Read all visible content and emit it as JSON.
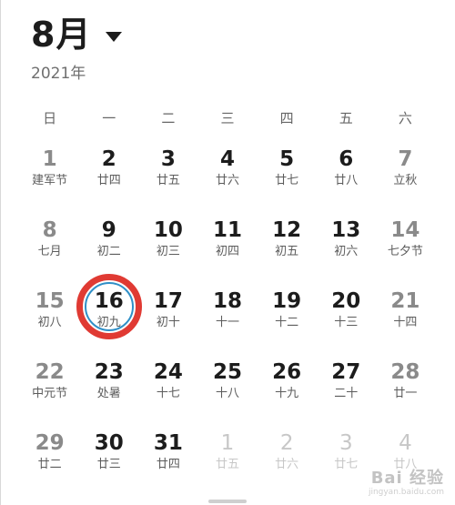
{
  "header": {
    "month_title": "8月",
    "year": "2021年"
  },
  "weekdays": [
    "日",
    "一",
    "二",
    "三",
    "四",
    "五",
    "六"
  ],
  "days": [
    {
      "num": "1",
      "lunar": "建军节",
      "kind": "weekend"
    },
    {
      "num": "2",
      "lunar": "廿四",
      "kind": "normal"
    },
    {
      "num": "3",
      "lunar": "廿五",
      "kind": "normal"
    },
    {
      "num": "4",
      "lunar": "廿六",
      "kind": "normal"
    },
    {
      "num": "5",
      "lunar": "廿七",
      "kind": "normal"
    },
    {
      "num": "6",
      "lunar": "廿八",
      "kind": "normal"
    },
    {
      "num": "7",
      "lunar": "立秋",
      "kind": "weekend"
    },
    {
      "num": "8",
      "lunar": "七月",
      "kind": "weekend"
    },
    {
      "num": "9",
      "lunar": "初二",
      "kind": "normal"
    },
    {
      "num": "10",
      "lunar": "初三",
      "kind": "normal"
    },
    {
      "num": "11",
      "lunar": "初四",
      "kind": "normal"
    },
    {
      "num": "12",
      "lunar": "初五",
      "kind": "normal"
    },
    {
      "num": "13",
      "lunar": "初六",
      "kind": "normal"
    },
    {
      "num": "14",
      "lunar": "七夕节",
      "kind": "weekend"
    },
    {
      "num": "15",
      "lunar": "初八",
      "kind": "weekend"
    },
    {
      "num": "16",
      "lunar": "初九",
      "kind": "today"
    },
    {
      "num": "17",
      "lunar": "初十",
      "kind": "normal"
    },
    {
      "num": "18",
      "lunar": "十一",
      "kind": "normal"
    },
    {
      "num": "19",
      "lunar": "十二",
      "kind": "normal"
    },
    {
      "num": "20",
      "lunar": "十三",
      "kind": "normal"
    },
    {
      "num": "21",
      "lunar": "十四",
      "kind": "weekend"
    },
    {
      "num": "22",
      "lunar": "中元节",
      "kind": "weekend"
    },
    {
      "num": "23",
      "lunar": "处暑",
      "kind": "normal"
    },
    {
      "num": "24",
      "lunar": "十七",
      "kind": "normal"
    },
    {
      "num": "25",
      "lunar": "十八",
      "kind": "normal"
    },
    {
      "num": "26",
      "lunar": "十九",
      "kind": "normal"
    },
    {
      "num": "27",
      "lunar": "二十",
      "kind": "normal"
    },
    {
      "num": "28",
      "lunar": "廿一",
      "kind": "weekend"
    },
    {
      "num": "29",
      "lunar": "廿二",
      "kind": "weekend"
    },
    {
      "num": "30",
      "lunar": "廿三",
      "kind": "normal"
    },
    {
      "num": "31",
      "lunar": "廿四",
      "kind": "normal"
    },
    {
      "num": "1",
      "lunar": "廿五",
      "kind": "other"
    },
    {
      "num": "2",
      "lunar": "廿六",
      "kind": "other"
    },
    {
      "num": "3",
      "lunar": "廿七",
      "kind": "other"
    },
    {
      "num": "4",
      "lunar": "廿八",
      "kind": "other"
    }
  ],
  "watermark": {
    "logo": "Bai 经验",
    "url": "jingyan.baidu.com"
  },
  "colors": {
    "today_ring": "#e03a33",
    "today_inner_ring": "#2f8fc7"
  }
}
